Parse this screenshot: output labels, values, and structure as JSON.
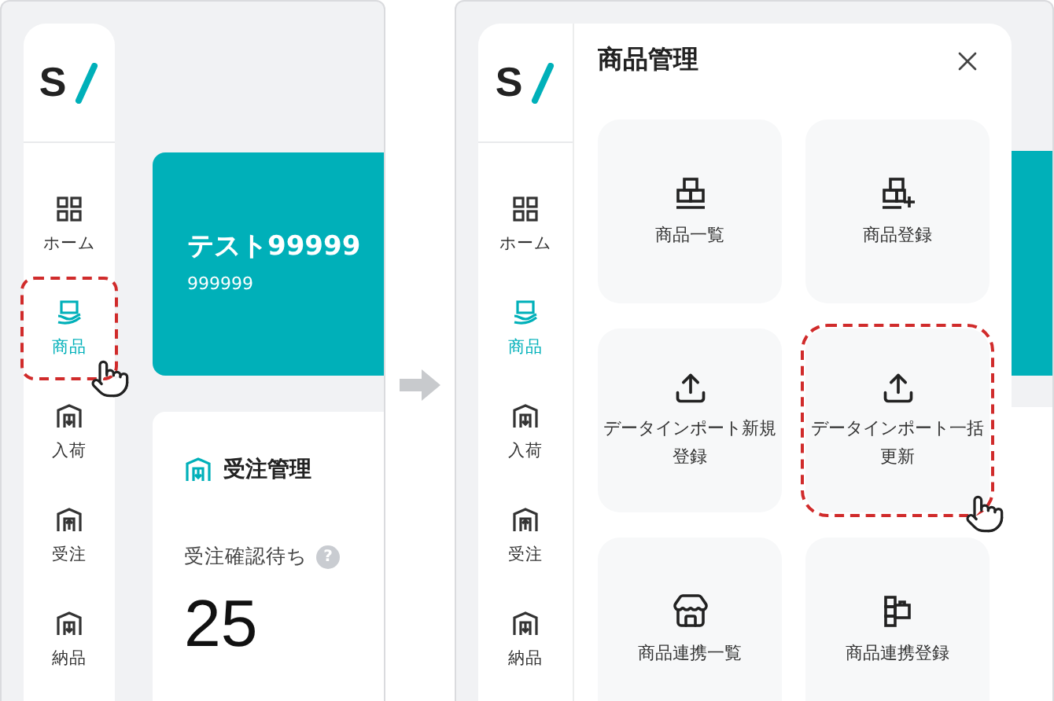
{
  "screens": [
    {
      "kind": "dashboard",
      "logo": "S",
      "nav": [
        {
          "label": "ホーム",
          "kind": "home",
          "selected": false,
          "highlighted": false
        },
        {
          "label": "商品",
          "kind": "product",
          "selected": true,
          "highlighted": true
        },
        {
          "label": "入荷",
          "kind": "inbound",
          "selected": false,
          "highlighted": false
        },
        {
          "label": "受注",
          "kind": "order",
          "selected": false,
          "highlighted": false
        },
        {
          "label": "納品",
          "kind": "delivery",
          "selected": false,
          "highlighted": false
        }
      ],
      "banner": {
        "title": "テスト99999",
        "code": "999999"
      },
      "card": {
        "title": "受注管理",
        "metric_label": "受注確認待ち",
        "help": "?",
        "value": "25"
      }
    },
    {
      "kind": "menu",
      "logo": "S",
      "nav": [
        {
          "label": "ホーム",
          "kind": "home",
          "selected": false,
          "highlighted": false
        },
        {
          "label": "商品",
          "kind": "product",
          "selected": true,
          "highlighted": false
        },
        {
          "label": "入荷",
          "kind": "inbound",
          "selected": false,
          "highlighted": false
        },
        {
          "label": "受注",
          "kind": "order",
          "selected": false,
          "highlighted": false
        },
        {
          "label": "納品",
          "kind": "delivery",
          "selected": false,
          "highlighted": false
        }
      ],
      "drawer": {
        "title": "商品管理",
        "tiles": [
          {
            "label": "商品一覧",
            "kind": "list",
            "highlighted": false
          },
          {
            "label": "商品登録",
            "kind": "register",
            "highlighted": false
          },
          {
            "label": "データインポート新規登録",
            "kind": "upload",
            "highlighted": false
          },
          {
            "label": "データインポート一括更新",
            "kind": "upload",
            "highlighted": true
          },
          {
            "label": "商品連携一覧",
            "kind": "store",
            "highlighted": false
          },
          {
            "label": "商品連携登録",
            "kind": "link",
            "highlighted": false
          }
        ]
      }
    }
  ]
}
